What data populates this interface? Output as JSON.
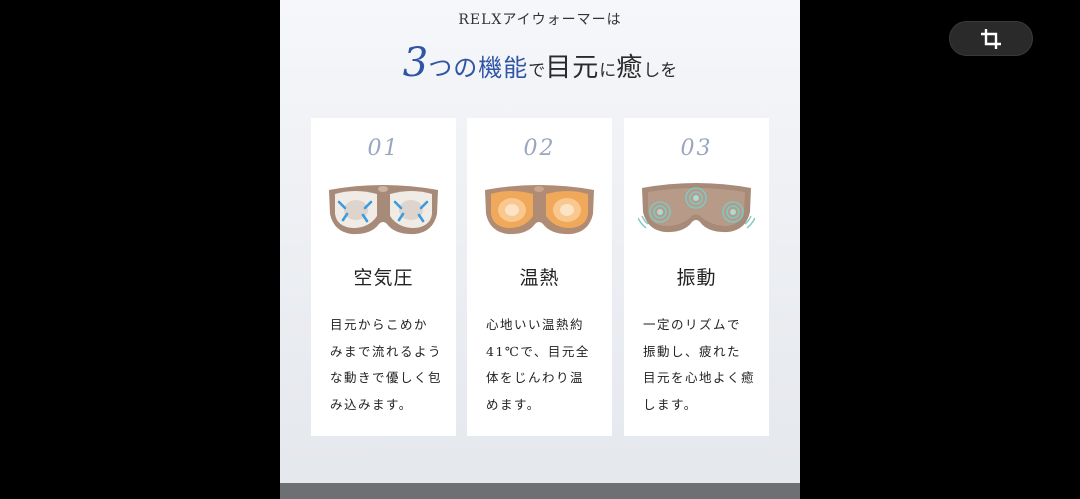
{
  "viewer": {
    "crop_icon": "crop-icon"
  },
  "page": {
    "subtitle": "RELXアイウォーマーは",
    "headline": {
      "number": "3",
      "part1": "つの機能",
      "part2": "で",
      "part3": "目元",
      "part4": "に",
      "part5": "癒",
      "part6": "しを"
    },
    "colors": {
      "accent": "#2f55a6",
      "number_label": "#9aa6bf",
      "card_bg": "#ffffff",
      "mask_brown": "#a88a78",
      "heat_orange": "#f0a85a",
      "vibration_teal": "#7fc8c0",
      "air_blue": "#3a9be0"
    },
    "features": [
      {
        "number": "01",
        "title": "空気圧",
        "icon": "air-pressure-mask-icon",
        "lines": [
          "目元からこめか",
          "みまで流れるよう",
          "な動きで優しく包",
          "み込みます。"
        ]
      },
      {
        "number": "02",
        "title": "温熱",
        "icon": "heat-mask-icon",
        "lines": [
          "心地いい温熱約",
          "41℃で、目元全",
          "体をじんわり温",
          "めます。"
        ]
      },
      {
        "number": "03",
        "title": "振動",
        "icon": "vibration-mask-icon",
        "lines": [
          "一定のリズムで",
          "振動し、疲れた",
          "目元を心地よく癒",
          "します。"
        ]
      }
    ]
  }
}
